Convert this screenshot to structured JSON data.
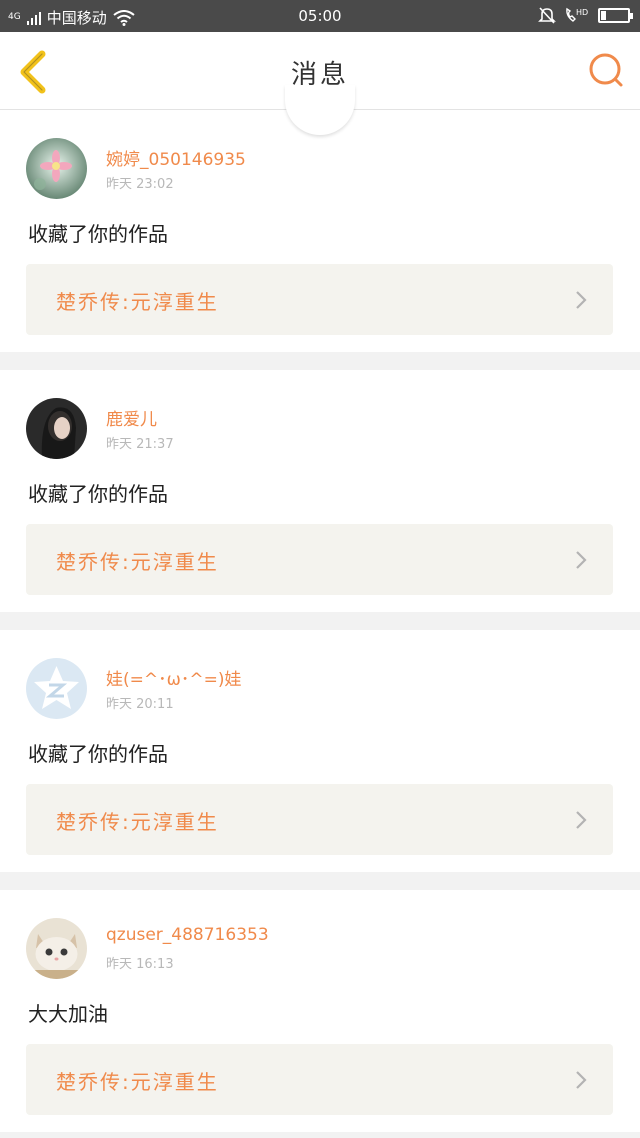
{
  "status_bar": {
    "network": "4G",
    "carrier": "中国移动",
    "time": "05:00",
    "hd_label": "HD",
    "battery_level": 0.2
  },
  "header": {
    "title": "消息",
    "back_icon": "chevron-left-icon",
    "search_icon": "search-icon"
  },
  "colors": {
    "accent": "#f08a4b",
    "back_icon": "#f2c21b",
    "card_bg": "#ffffff",
    "page_bg": "#f2f2f2",
    "work_bg": "#f4f3ee"
  },
  "messages": [
    {
      "username": "婉婷_050146935",
      "time": "昨天 23:02",
      "content": "收藏了你的作品",
      "work_title": "楚乔传:元淳重生",
      "avatar": "flower-avatar"
    },
    {
      "username": "鹿爱儿",
      "time": "昨天 21:37",
      "content": "收藏了你的作品",
      "work_title": "楚乔传:元淳重生",
      "avatar": "portrait-avatar"
    },
    {
      "username": "娃(=^･ω･^=)娃",
      "time": "昨天 20:11",
      "content": "收藏了你的作品",
      "work_title": "楚乔传:元淳重生",
      "avatar": "qzone-default-avatar"
    },
    {
      "username": "qzuser_488716353",
      "time": "昨天 16:13",
      "content": "大大加油",
      "work_title": "楚乔传:元淳重生",
      "avatar": "cat-avatar"
    }
  ]
}
